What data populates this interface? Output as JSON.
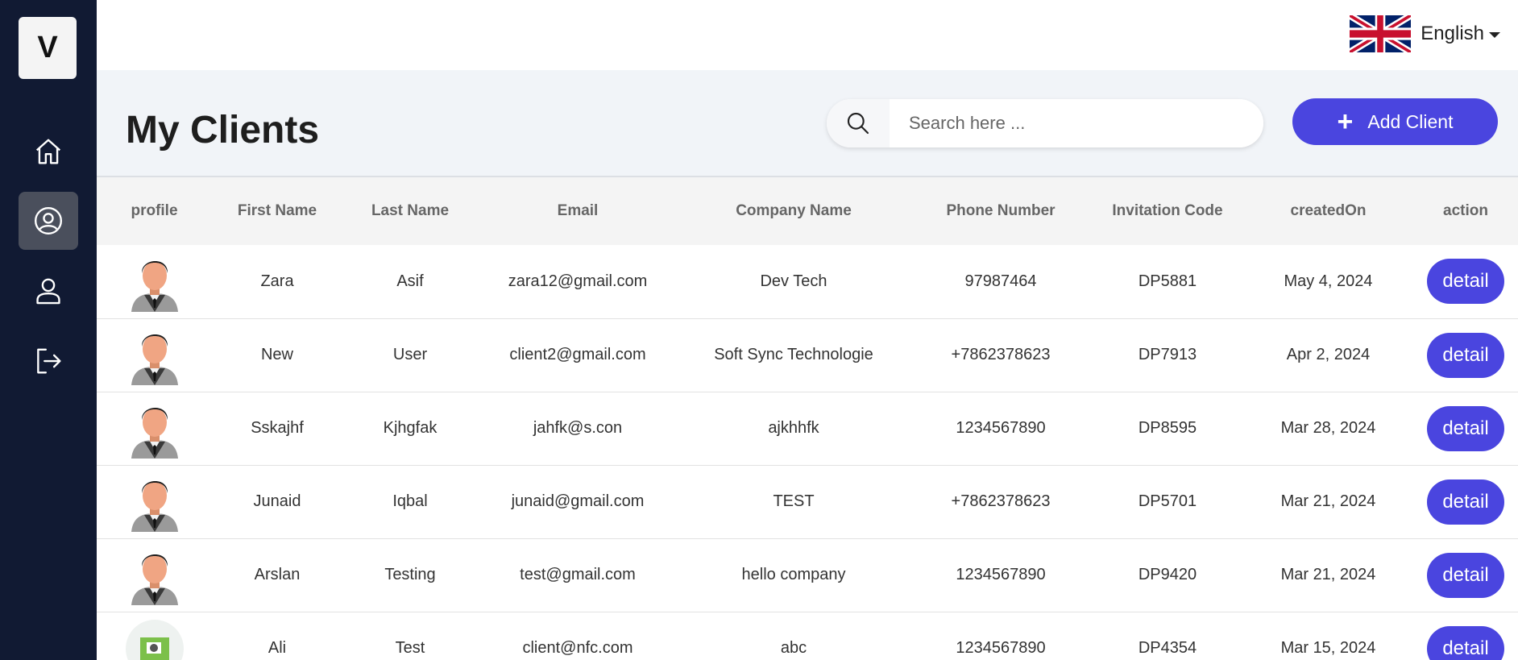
{
  "sidebar": {
    "logo": "V",
    "items": [
      {
        "icon": "home-icon"
      },
      {
        "icon": "clients-icon",
        "active": true
      },
      {
        "icon": "user-icon"
      },
      {
        "icon": "logout-icon"
      }
    ]
  },
  "topbar": {
    "language": "English",
    "flag_icon": "uk-flag-icon"
  },
  "page": {
    "title": "My Clients"
  },
  "search": {
    "placeholder": "Search here ...",
    "value": ""
  },
  "add_client": {
    "label": "Add Client"
  },
  "colors": {
    "sidebar": "#111a33",
    "accent": "#4a45df",
    "background": "#f1f4f8"
  },
  "table": {
    "headers": [
      "profile",
      "First Name",
      "Last Name",
      "Email",
      "Company Name",
      "Phone Number",
      "Invitation Code",
      "createdOn",
      "action"
    ],
    "rows": [
      {
        "first": "Zara",
        "last": "Asif",
        "email": "zara12@gmail.com",
        "company": "Dev Tech",
        "phone": "97987464",
        "code": "DP5881",
        "created": "May 4, 2024",
        "action": "detail",
        "avatar": "default-avatar"
      },
      {
        "first": "New",
        "last": "User",
        "email": "client2@gmail.com",
        "company": "Soft Sync Technologie",
        "phone": "+7862378623",
        "code": "DP7913",
        "created": "Apr 2, 2024",
        "action": "detail",
        "avatar": "default-avatar"
      },
      {
        "first": "Sskajhf",
        "last": "Kjhgfak",
        "email": "jahfk@s.con",
        "company": "ajkhhfk",
        "phone": "1234567890",
        "code": "DP8595",
        "created": "Mar 28, 2024",
        "action": "detail",
        "avatar": "default-avatar"
      },
      {
        "first": "Junaid",
        "last": "Iqbal",
        "email": "junaid@gmail.com",
        "company": "TEST",
        "phone": "+7862378623",
        "code": "DP5701",
        "created": "Mar 21, 2024",
        "action": "detail",
        "avatar": "default-avatar"
      },
      {
        "first": "Arslan",
        "last": "Testing",
        "email": "test@gmail.com",
        "company": "hello company",
        "phone": "1234567890",
        "code": "DP9420",
        "created": "Mar 21, 2024",
        "action": "detail",
        "avatar": "default-avatar"
      },
      {
        "first": "Ali",
        "last": "Test",
        "email": "client@nfc.com",
        "company": "abc",
        "phone": "1234567890",
        "code": "DP4354",
        "created": "Mar 15, 2024",
        "action": "detail",
        "avatar": "photo-avatar"
      }
    ]
  }
}
